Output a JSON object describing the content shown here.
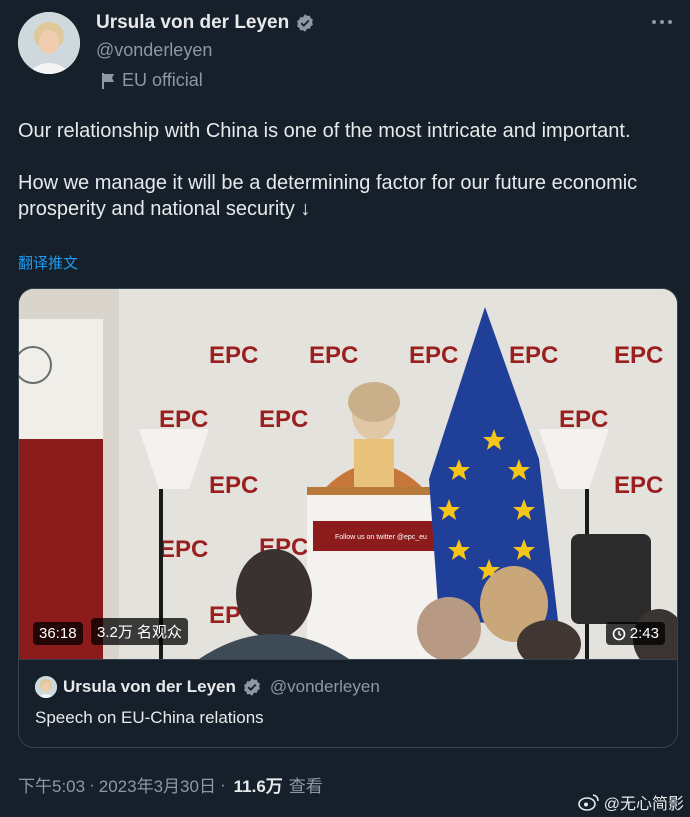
{
  "author": {
    "name": "Ursula von der Leyen",
    "handle": "@vonderleyen",
    "label": "EU official"
  },
  "tweet": {
    "text": "Our relationship with China is one of the most intricate and important.\n\nHow we manage it will be a determining factor for our future economic prosperity and national security ↓",
    "translate": "翻译推文"
  },
  "video": {
    "duration": "36:18",
    "views": "3.2万 名观众",
    "replay_time": "2:43",
    "epc_logo": "EPC",
    "podium_text": "Follow us on twitter\n@epc_eu"
  },
  "quote": {
    "name": "Ursula von der Leyen",
    "handle": "@vonderleyen",
    "text": "Speech on EU-China relations"
  },
  "footer": {
    "time": "下午5:03",
    "date": "2023年3月30日",
    "views_count": "11.6万",
    "views_label": "查看"
  },
  "watermark": "@无心简影",
  "colors": {
    "background": "#15202b",
    "link": "#1d9bf0",
    "secondary": "#8b98a5",
    "verified": "#8b98a5",
    "eu_blue": "#1f3f99",
    "eu_star": "#f5c518",
    "epc_red": "#8c1b1b"
  },
  "icons": {
    "verified": "verified-badge-icon",
    "label": "flag-icon",
    "more": "more-icon",
    "replay": "replay-icon",
    "weibo": "weibo-icon"
  }
}
